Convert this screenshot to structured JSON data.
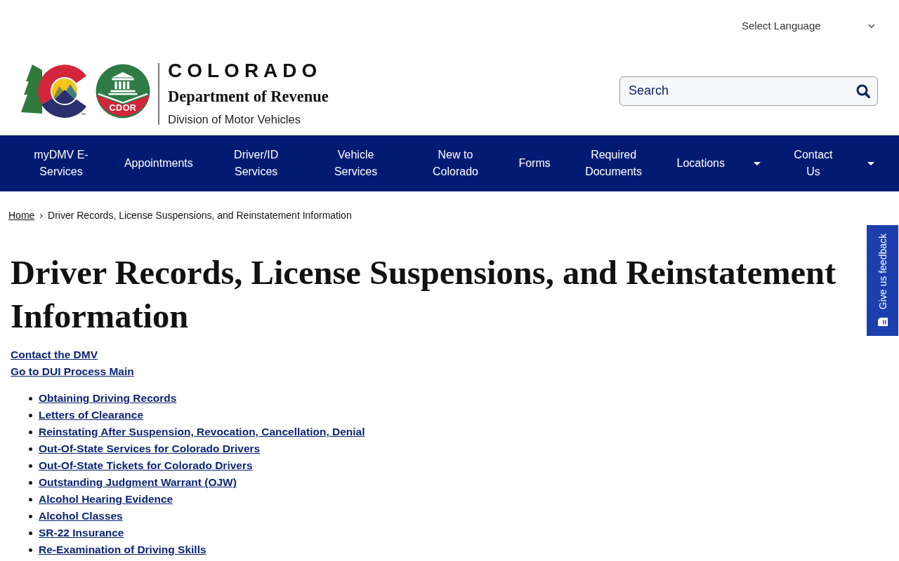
{
  "language_select": {
    "label": "Select Language"
  },
  "header": {
    "trademark": "™",
    "seal_label": "CDOR",
    "agency_name": "COLORADO",
    "department": "Department of Revenue",
    "division": "Division of Motor Vehicles"
  },
  "search": {
    "placeholder": "Search"
  },
  "nav": {
    "items": [
      {
        "label": "myDMV E-Services",
        "dropdown": false
      },
      {
        "label": "Appointments",
        "dropdown": false
      },
      {
        "label": "Driver/ID Services",
        "dropdown": false
      },
      {
        "label": "Vehicle Services",
        "dropdown": false
      },
      {
        "label": "New to Colorado",
        "dropdown": false
      },
      {
        "label": "Forms",
        "dropdown": false
      },
      {
        "label": "Required Documents",
        "dropdown": false
      },
      {
        "label": "Locations",
        "dropdown": true
      },
      {
        "label": "Contact Us",
        "dropdown": true
      }
    ]
  },
  "breadcrumb": {
    "separator": "›",
    "items": [
      {
        "label": "Home",
        "kind": "link"
      },
      {
        "label": "Driver Records, License Suspensions, and Reinstatement Information",
        "kind": "current"
      }
    ]
  },
  "page": {
    "title": "Driver Records, License Suspensions, and Reinstatement Information",
    "quick_links": [
      "Contact the DMV",
      "Go to DUI Process Main"
    ],
    "topics": [
      "Obtaining Driving Records",
      "Letters of Clearance",
      "Reinstating After Suspension, Revocation, Cancellation, Denial",
      "Out-Of-State Services for Colorado Drivers",
      "Out-Of-State Tickets for Colorado Drivers",
      "Outstanding Judgment Warrant (OJW)",
      "Alcohol Hearing Evidence",
      "Alcohol Classes",
      "SR-22 Insurance",
      "Re-Examination of Driving Skills"
    ]
  },
  "feedback_tab": {
    "label": "Give us feedback"
  }
}
